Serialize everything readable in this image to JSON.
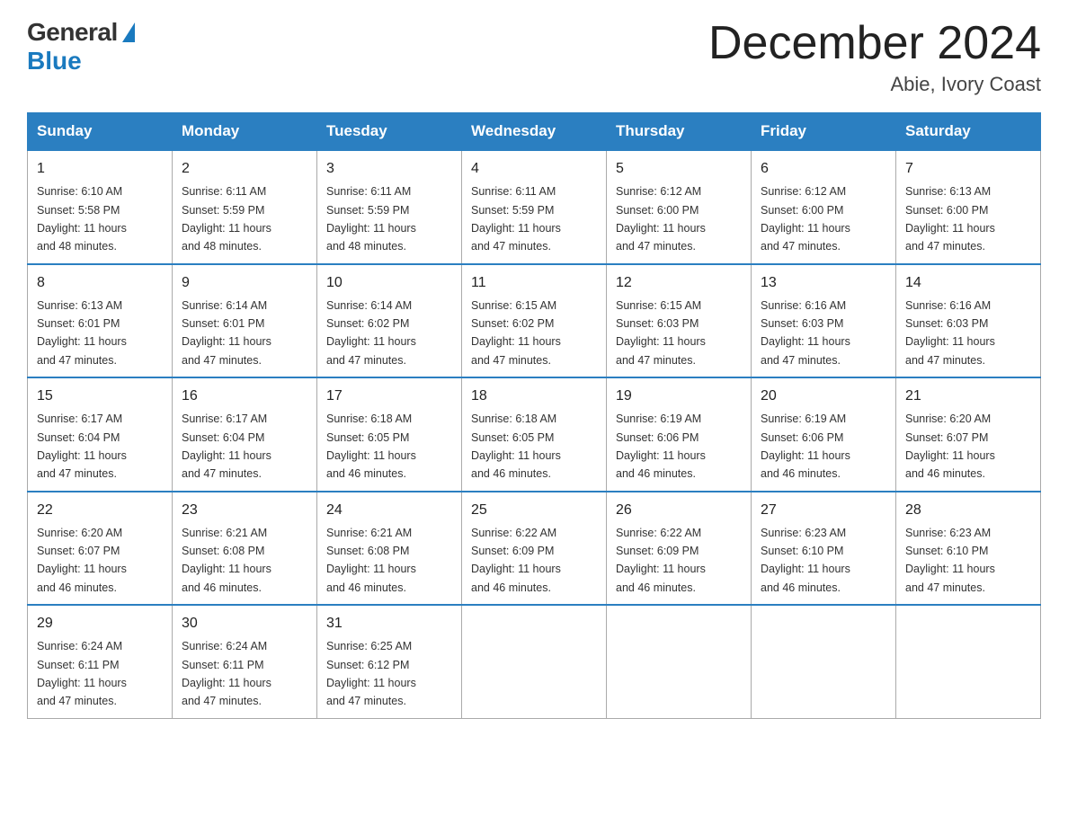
{
  "header": {
    "logo_general": "General",
    "logo_blue": "Blue",
    "month_title": "December 2024",
    "location": "Abie, Ivory Coast"
  },
  "days_of_week": [
    "Sunday",
    "Monday",
    "Tuesday",
    "Wednesday",
    "Thursday",
    "Friday",
    "Saturday"
  ],
  "weeks": [
    [
      {
        "day": "1",
        "sunrise": "6:10 AM",
        "sunset": "5:58 PM",
        "daylight": "11 hours and 48 minutes."
      },
      {
        "day": "2",
        "sunrise": "6:11 AM",
        "sunset": "5:59 PM",
        "daylight": "11 hours and 48 minutes."
      },
      {
        "day": "3",
        "sunrise": "6:11 AM",
        "sunset": "5:59 PM",
        "daylight": "11 hours and 48 minutes."
      },
      {
        "day": "4",
        "sunrise": "6:11 AM",
        "sunset": "5:59 PM",
        "daylight": "11 hours and 47 minutes."
      },
      {
        "day": "5",
        "sunrise": "6:12 AM",
        "sunset": "6:00 PM",
        "daylight": "11 hours and 47 minutes."
      },
      {
        "day": "6",
        "sunrise": "6:12 AM",
        "sunset": "6:00 PM",
        "daylight": "11 hours and 47 minutes."
      },
      {
        "day": "7",
        "sunrise": "6:13 AM",
        "sunset": "6:00 PM",
        "daylight": "11 hours and 47 minutes."
      }
    ],
    [
      {
        "day": "8",
        "sunrise": "6:13 AM",
        "sunset": "6:01 PM",
        "daylight": "11 hours and 47 minutes."
      },
      {
        "day": "9",
        "sunrise": "6:14 AM",
        "sunset": "6:01 PM",
        "daylight": "11 hours and 47 minutes."
      },
      {
        "day": "10",
        "sunrise": "6:14 AM",
        "sunset": "6:02 PM",
        "daylight": "11 hours and 47 minutes."
      },
      {
        "day": "11",
        "sunrise": "6:15 AM",
        "sunset": "6:02 PM",
        "daylight": "11 hours and 47 minutes."
      },
      {
        "day": "12",
        "sunrise": "6:15 AM",
        "sunset": "6:03 PM",
        "daylight": "11 hours and 47 minutes."
      },
      {
        "day": "13",
        "sunrise": "6:16 AM",
        "sunset": "6:03 PM",
        "daylight": "11 hours and 47 minutes."
      },
      {
        "day": "14",
        "sunrise": "6:16 AM",
        "sunset": "6:03 PM",
        "daylight": "11 hours and 47 minutes."
      }
    ],
    [
      {
        "day": "15",
        "sunrise": "6:17 AM",
        "sunset": "6:04 PM",
        "daylight": "11 hours and 47 minutes."
      },
      {
        "day": "16",
        "sunrise": "6:17 AM",
        "sunset": "6:04 PM",
        "daylight": "11 hours and 47 minutes."
      },
      {
        "day": "17",
        "sunrise": "6:18 AM",
        "sunset": "6:05 PM",
        "daylight": "11 hours and 46 minutes."
      },
      {
        "day": "18",
        "sunrise": "6:18 AM",
        "sunset": "6:05 PM",
        "daylight": "11 hours and 46 minutes."
      },
      {
        "day": "19",
        "sunrise": "6:19 AM",
        "sunset": "6:06 PM",
        "daylight": "11 hours and 46 minutes."
      },
      {
        "day": "20",
        "sunrise": "6:19 AM",
        "sunset": "6:06 PM",
        "daylight": "11 hours and 46 minutes."
      },
      {
        "day": "21",
        "sunrise": "6:20 AM",
        "sunset": "6:07 PM",
        "daylight": "11 hours and 46 minutes."
      }
    ],
    [
      {
        "day": "22",
        "sunrise": "6:20 AM",
        "sunset": "6:07 PM",
        "daylight": "11 hours and 46 minutes."
      },
      {
        "day": "23",
        "sunrise": "6:21 AM",
        "sunset": "6:08 PM",
        "daylight": "11 hours and 46 minutes."
      },
      {
        "day": "24",
        "sunrise": "6:21 AM",
        "sunset": "6:08 PM",
        "daylight": "11 hours and 46 minutes."
      },
      {
        "day": "25",
        "sunrise": "6:22 AM",
        "sunset": "6:09 PM",
        "daylight": "11 hours and 46 minutes."
      },
      {
        "day": "26",
        "sunrise": "6:22 AM",
        "sunset": "6:09 PM",
        "daylight": "11 hours and 46 minutes."
      },
      {
        "day": "27",
        "sunrise": "6:23 AM",
        "sunset": "6:10 PM",
        "daylight": "11 hours and 46 minutes."
      },
      {
        "day": "28",
        "sunrise": "6:23 AM",
        "sunset": "6:10 PM",
        "daylight": "11 hours and 47 minutes."
      }
    ],
    [
      {
        "day": "29",
        "sunrise": "6:24 AM",
        "sunset": "6:11 PM",
        "daylight": "11 hours and 47 minutes."
      },
      {
        "day": "30",
        "sunrise": "6:24 AM",
        "sunset": "6:11 PM",
        "daylight": "11 hours and 47 minutes."
      },
      {
        "day": "31",
        "sunrise": "6:25 AM",
        "sunset": "6:12 PM",
        "daylight": "11 hours and 47 minutes."
      },
      null,
      null,
      null,
      null
    ]
  ],
  "labels": {
    "sunrise": "Sunrise:",
    "sunset": "Sunset:",
    "daylight": "Daylight:"
  }
}
